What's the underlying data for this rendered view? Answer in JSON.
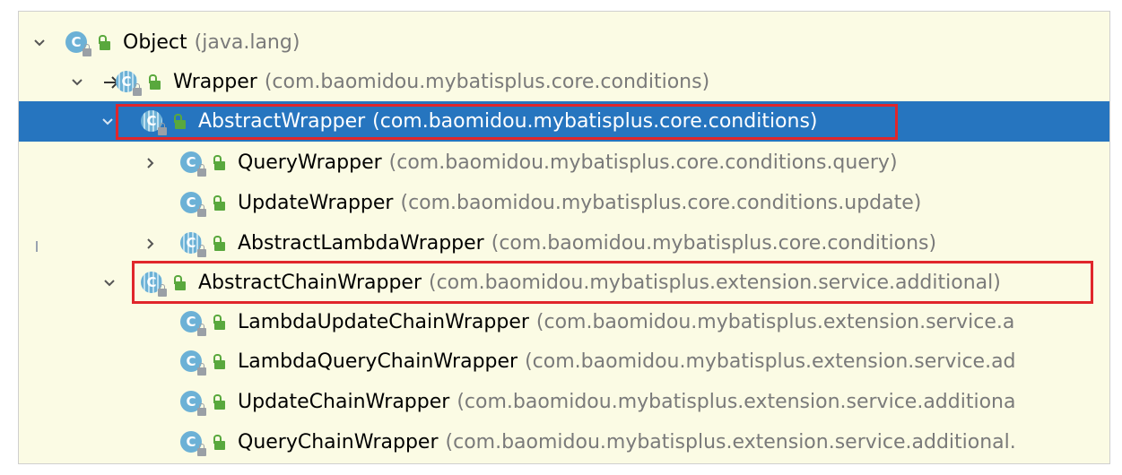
{
  "tree": {
    "rows": [
      {
        "name": "Object",
        "pkg": "(java.lang)",
        "icon": "class-icon",
        "expanded": true,
        "implements_arrow": false
      },
      {
        "name": "Wrapper",
        "pkg": "(com.baomidou.mybatisplus.core.conditions)",
        "icon": "abstract-class-icon",
        "expanded": true,
        "implements_arrow": true
      },
      {
        "name": "AbstractWrapper",
        "pkg": "(com.baomidou.mybatisplus.core.conditions)",
        "icon": "abstract-class-icon",
        "expanded": true,
        "selected": true,
        "highlighted": true
      },
      {
        "name": "QueryWrapper",
        "pkg": "(com.baomidou.mybatisplus.core.conditions.query)",
        "icon": "class-icon",
        "expanded": false
      },
      {
        "name": "UpdateWrapper",
        "pkg": "(com.baomidou.mybatisplus.core.conditions.update)",
        "icon": "class-icon"
      },
      {
        "name": "AbstractLambdaWrapper",
        "pkg": "(com.baomidou.mybatisplus.core.conditions)",
        "icon": "abstract-class-icon",
        "expanded": false
      },
      {
        "name": "AbstractChainWrapper",
        "pkg": "(com.baomidou.mybatisplus.extension.service.additional)",
        "icon": "abstract-class-icon",
        "expanded": true,
        "highlighted": true
      },
      {
        "name": "LambdaUpdateChainWrapper",
        "pkg": "(com.baomidou.mybatisplus.extension.service.a",
        "icon": "class-icon"
      },
      {
        "name": "LambdaQueryChainWrapper",
        "pkg": "(com.baomidou.mybatisplus.extension.service.ad",
        "icon": "class-icon"
      },
      {
        "name": "UpdateChainWrapper",
        "pkg": "(com.baomidou.mybatisplus.extension.service.additiona",
        "icon": "class-icon"
      },
      {
        "name": "QueryChainWrapper",
        "pkg": "(com.baomidou.mybatisplus.extension.service.additional.",
        "icon": "class-icon"
      }
    ],
    "icon_letter": "C"
  },
  "colors": {
    "background": "#fbfbe4",
    "selection": "#2675bf",
    "highlight_border": "#e0262b",
    "class_icon": "#6cb1d6",
    "visibility_icon": "#59a83d",
    "package_text": "#7a7a7a"
  }
}
